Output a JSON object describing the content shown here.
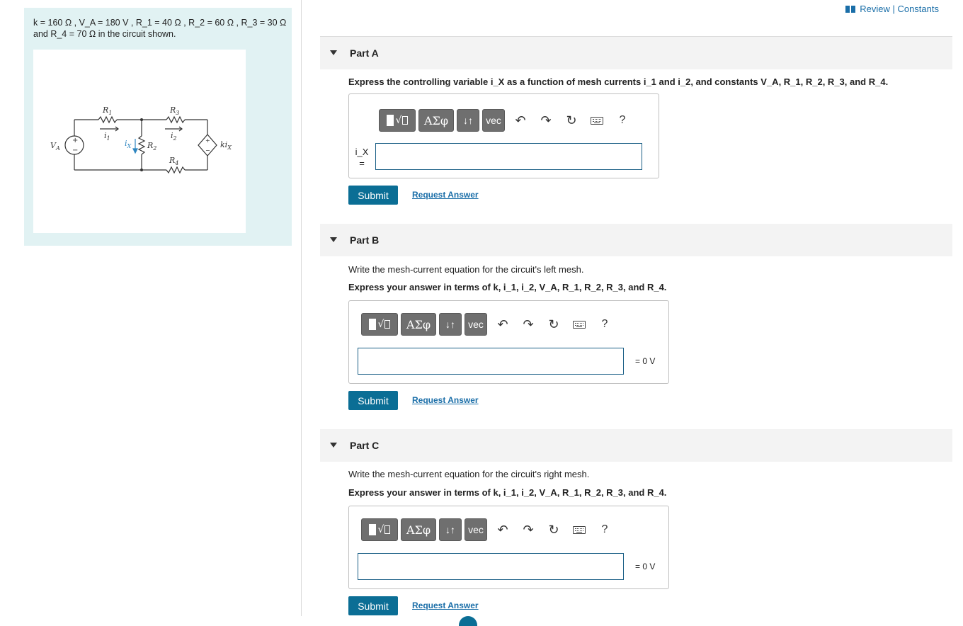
{
  "header": {
    "review_link": "Review | Constants"
  },
  "problem": {
    "intro_text": "k = 160 Ω , V_A = 180 V , R_1 = 40 Ω , R_2 = 60 Ω , R_3 = 30 Ω and R_4 = 70 Ω in the circuit shown."
  },
  "circuit": {
    "labels": {
      "r1": "R",
      "r1_sub": "1",
      "r2": "R",
      "r2_sub": "2",
      "r3": "R",
      "r3_sub": "3",
      "r4": "R",
      "r4_sub": "4",
      "va": "V",
      "va_sub": "A",
      "i1": "i",
      "i1_sub": "1",
      "i2": "i",
      "i2_sub": "2",
      "ix": "i",
      "ix_sub": "X",
      "kix": "ki",
      "kix_sub": "X",
      "plus": "+",
      "minus": "−"
    },
    "colors": {
      "wire": "#333333",
      "ix_arrow": "#2e86c1"
    }
  },
  "toolbar": {
    "greek_label": "ΑΣφ",
    "arrows_label": "↓↑",
    "vec_label": "vec",
    "help_label": "?"
  },
  "parts": [
    {
      "title": "Part A",
      "prompt_text": "Express the controlling variable i_X as a function of mesh currents i_1 and i_2, and constants V_A, R_1, R_2, R_3, and R_4.",
      "input_label": "i_X =",
      "input_value": "",
      "submit_label": "Submit",
      "request_label": "Request Answer"
    },
    {
      "title": "Part B",
      "description": "Write the mesh-current equation for the circuit's left mesh.",
      "prompt_text": "Express your answer in terms of k, i_1, i_2, V_A, R_1, R_2, R_3, and R_4.",
      "suffix": "= 0 V",
      "input_value": "",
      "submit_label": "Submit",
      "request_label": "Request Answer"
    },
    {
      "title": "Part C",
      "description": "Write the mesh-current equation for the circuit's right mesh.",
      "prompt_text": "Express your answer in terms of k, i_1, i_2, V_A, R_1, R_2, R_3, and R_4.",
      "suffix": "= 0 V",
      "input_value": "",
      "submit_label": "Submit",
      "request_label": "Request Answer"
    }
  ],
  "colors": {
    "accent": "#0b6e95",
    "link": "#1a6ea8",
    "panel_bg": "#e1f2f3",
    "part_header_bg": "#f3f3f3"
  }
}
